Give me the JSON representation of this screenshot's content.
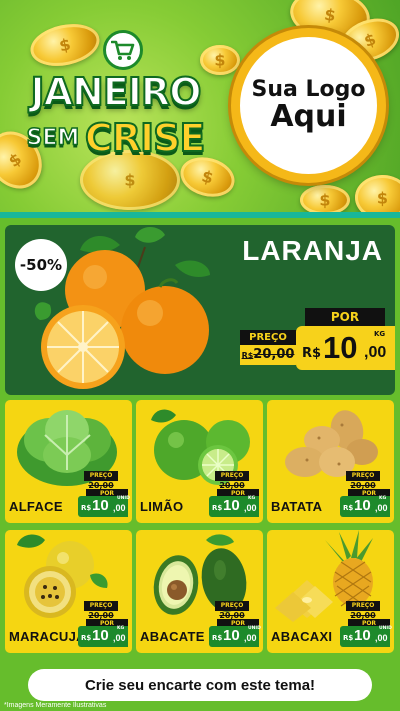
{
  "header": {
    "title_line1": "JANEIRO",
    "title_line2_small": "SEM",
    "title_line2_big": "CRISE",
    "logo_line1": "Sua Logo",
    "logo_line2": "Aqui"
  },
  "hero": {
    "discount": "-50%",
    "name": "LARANJA",
    "por_label": "POR",
    "preco_label": "PREÇO",
    "old_currency": "R$",
    "old_price": "20,00",
    "currency": "R$",
    "price_int": "10",
    "price_dec": ",00",
    "unit": "KG"
  },
  "products": [
    {
      "name": "ALFACE",
      "preco_label": "PREÇO",
      "old_price": "20,00",
      "por_label": "POR",
      "currency": "R$",
      "price_int": "10",
      "price_dec": ",00",
      "unit": "UNID"
    },
    {
      "name": "LIMÃO",
      "preco_label": "PREÇO",
      "old_price": "20,00",
      "por_label": "POR",
      "currency": "R$",
      "price_int": "10",
      "price_dec": ",00",
      "unit": "KG"
    },
    {
      "name": "BATATA",
      "preco_label": "PREÇO",
      "old_price": "20,00",
      "por_label": "POR",
      "currency": "R$",
      "price_int": "10",
      "price_dec": ",00",
      "unit": "KG"
    },
    {
      "name": "MARACUJÁ",
      "preco_label": "PREÇO",
      "old_price": "20,00",
      "por_label": "POR",
      "currency": "R$",
      "price_int": "10",
      "price_dec": ",00",
      "unit": "KG"
    },
    {
      "name": "ABACATE",
      "preco_label": "PREÇO",
      "old_price": "20,00",
      "por_label": "POR",
      "currency": "R$",
      "price_int": "10",
      "price_dec": ",00",
      "unit": "UNID"
    },
    {
      "name": "ABACAXI",
      "preco_label": "PREÇO",
      "old_price": "20,00",
      "por_label": "POR",
      "currency": "R$",
      "price_int": "10",
      "price_dec": ",00",
      "unit": "UNID"
    }
  ],
  "footer": {
    "cta": "Crie seu encarte com este tema!",
    "disclaimer": "*Imagens Meramente Ilustrativas"
  },
  "colors": {
    "brand_green": "#1d8a2b",
    "dark_green": "#21642e",
    "yellow": "#f5d612",
    "teal": "#18b79a"
  }
}
